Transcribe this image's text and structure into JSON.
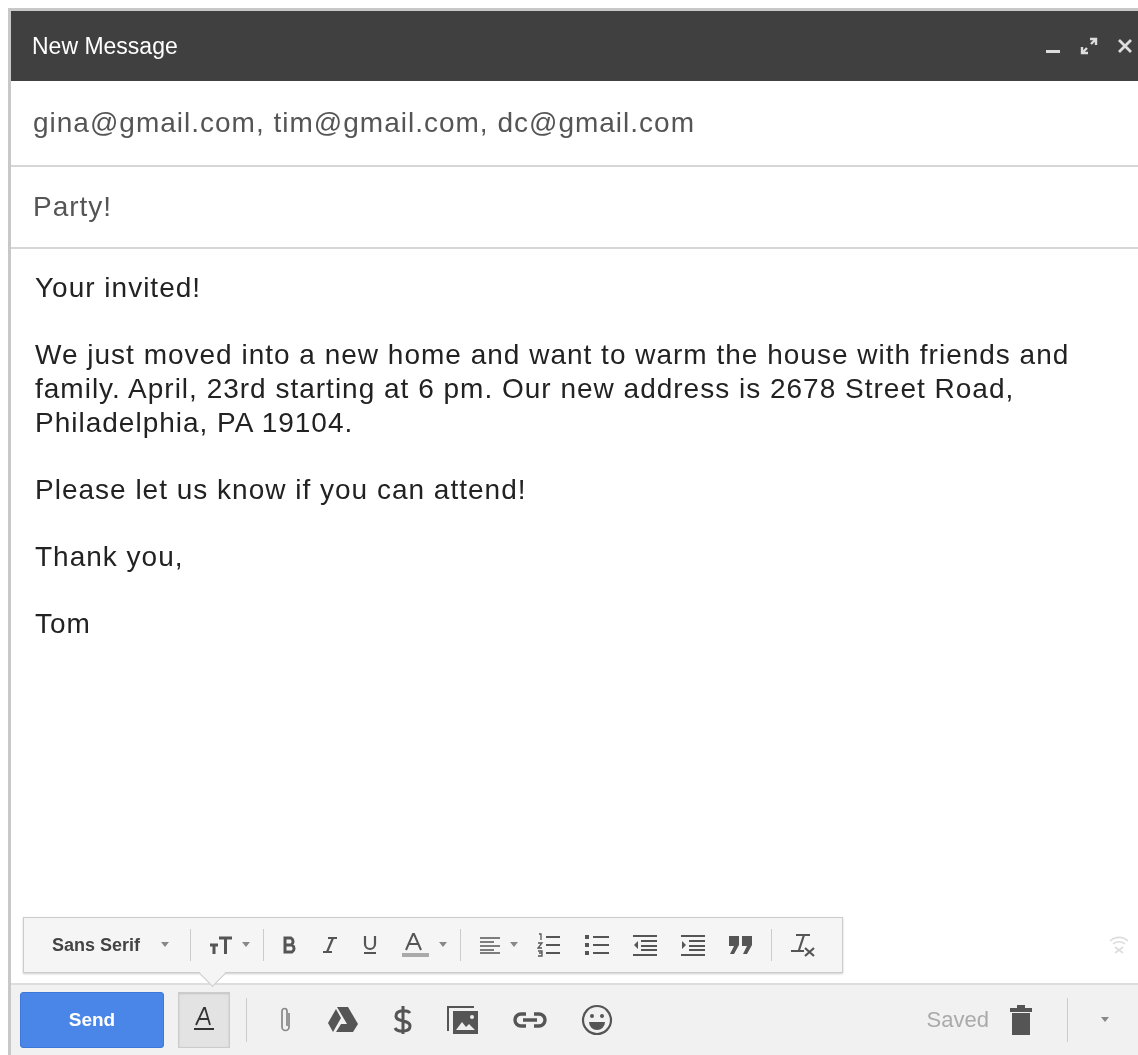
{
  "window": {
    "title": "New Message"
  },
  "to": {
    "value": "gina@gmail.com, tim@gmail.com, dc@gmail.com"
  },
  "subject": {
    "value": "Party!"
  },
  "body": {
    "paragraphs": [
      "Your invited!",
      "We just moved into a new home and want to warm the house with friends and family. April, 23rd starting at 6 pm. Our new address is 2678 Street Road, Philadelphia, PA 19104.",
      "Please let us know if you can attend!",
      "Thank you,",
      "Tom"
    ]
  },
  "formatting_toolbar": {
    "font": "Sans Serif"
  },
  "bottom_bar": {
    "send": "Send",
    "formatting_toggle": {
      "selected": true
    },
    "status": "Saved"
  }
}
